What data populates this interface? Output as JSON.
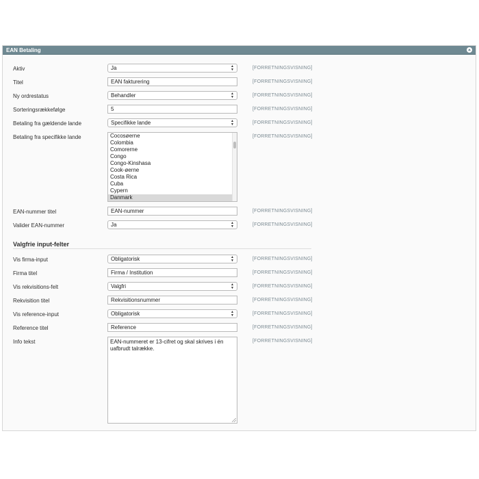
{
  "section": {
    "title": "EAN Betaling",
    "scope_label": "[FORRETNINGSVISNING]"
  },
  "fields": {
    "aktiv": {
      "label": "Aktiv",
      "value": "Ja"
    },
    "titel": {
      "label": "Titel",
      "value": "EAN fakturering"
    },
    "ny_ordrestatus": {
      "label": "Ny ordrestatus",
      "value": "Behandler"
    },
    "sortering": {
      "label": "Sorteringsrækkefølge",
      "value": "5"
    },
    "betaling_gaeldende": {
      "label": "Betaling fra gældende lande",
      "value": "Specifikke lande"
    },
    "betaling_specifikke": {
      "label": "Betaling fra specifikke lande",
      "options": [
        "Cocosøerne",
        "Colombia",
        "Comorerne",
        "Congo",
        "Congo-Kinshasa",
        "Cook-øerne",
        "Costa Rica",
        "Cuba",
        "Cypern",
        "Danmark"
      ],
      "selected": "Danmark"
    },
    "ean_titel": {
      "label": "EAN-nummer titel",
      "value": "EAN-nummer"
    },
    "valider_ean": {
      "label": "Valider EAN-nummer",
      "value": "Ja"
    }
  },
  "optional_group": {
    "title": "Valgfrie input-felter",
    "fields": {
      "vis_firma": {
        "label": "Vis firma-input",
        "value": "Obligatorisk"
      },
      "firma_titel": {
        "label": "Firma titel",
        "value": "Firma / Institution"
      },
      "vis_rekvisition": {
        "label": "Vis rekvisitions-felt",
        "value": "Valgfri"
      },
      "rekvisition_titel": {
        "label": "Rekvisition titel",
        "value": "Rekvisitionsnummer"
      },
      "vis_reference": {
        "label": "Vis reference-input",
        "value": "Obligatorisk"
      },
      "reference_titel": {
        "label": "Reference titel",
        "value": "Reference"
      },
      "info_tekst": {
        "label": "Info tekst",
        "value": "EAN-nummeret er 13-cifret og skal skrives i én uafbrudt talrække."
      }
    }
  },
  "icons": {
    "collapse": "collapse-arrow-icon",
    "select_arrows": "⇕"
  }
}
